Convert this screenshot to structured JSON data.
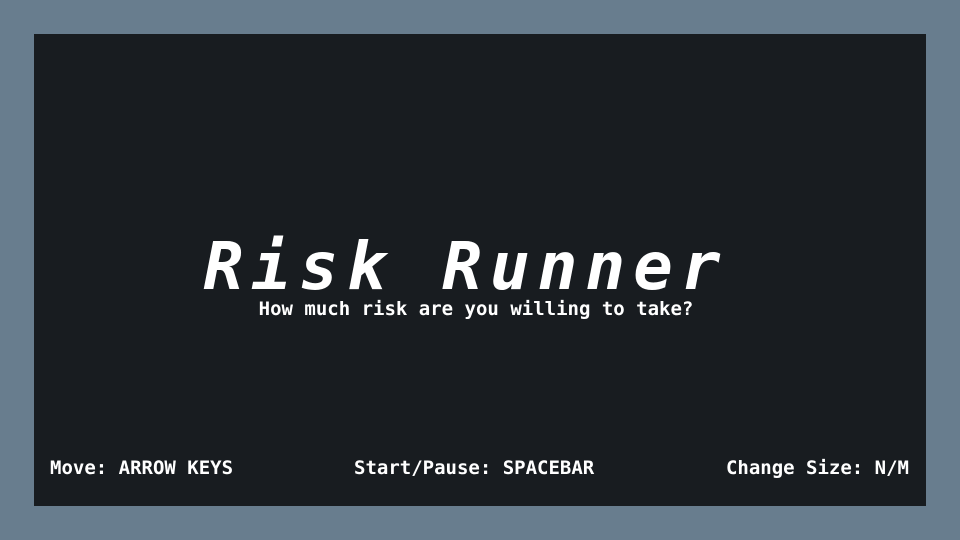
{
  "game": {
    "title": "Risk Runner",
    "subtitle": "How much risk are you willing to take?"
  },
  "controls": {
    "move": "Move: ARROW KEYS",
    "start_pause": "Start/Pause: SPACEBAR",
    "change_size": "Change Size: N/M"
  },
  "colors": {
    "frame": "#687d8e",
    "canvas": "#181c20",
    "text": "#ffffff"
  }
}
